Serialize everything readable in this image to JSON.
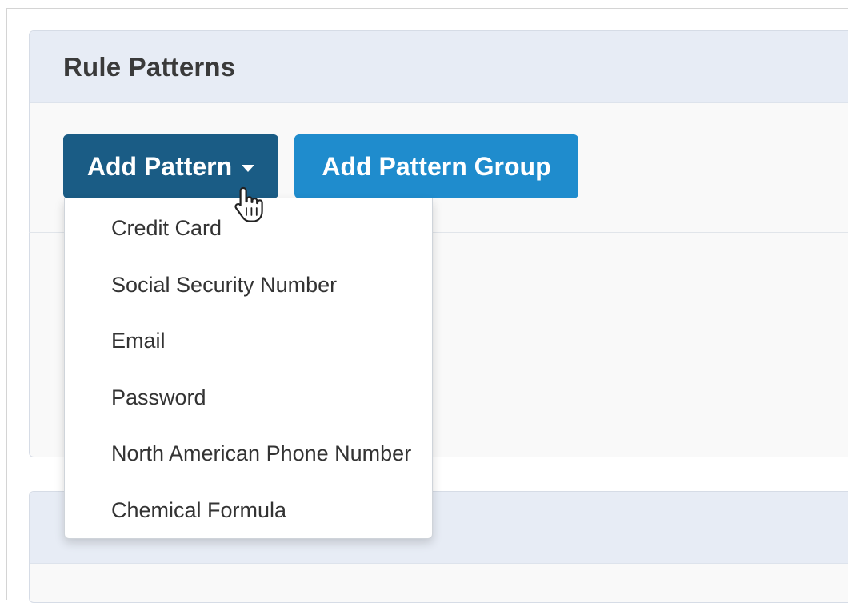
{
  "rule_patterns_panel": {
    "title": "Rule Patterns",
    "add_pattern_label": "Add Pattern",
    "add_pattern_group_label": "Add Pattern Group"
  },
  "add_pattern_dropdown": {
    "items": [
      "Credit Card",
      "Social Security Number",
      "Email",
      "Password",
      "North American Phone Number",
      "Chemical Formula"
    ]
  },
  "icons": {
    "dropdown_caret": "caret-down-icon",
    "pointer": "hand-pointer-cursor-icon"
  },
  "colors": {
    "add_pattern_button": "#1a5c85",
    "add_pattern_group_button": "#1f8ccd",
    "panel_heading": "#e7ecf5"
  }
}
